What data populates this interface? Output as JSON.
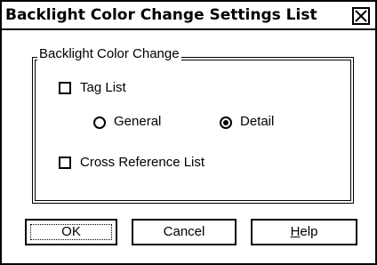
{
  "window": {
    "title": "Backlight Color Change Settings List"
  },
  "group": {
    "legend": "Backlight Color Change",
    "tag_list_label": "Tag List",
    "tag_list_checked": false,
    "radio_general_label": "General",
    "radio_detail_label": "Detail",
    "selected_radio": "Detail",
    "cross_reference_label": "Cross Reference List",
    "cross_reference_checked": false
  },
  "buttons": {
    "ok_label": "OK",
    "cancel_label": "Cancel",
    "help_label_access_key": "H",
    "help_label_rest": "elp"
  },
  "icons": {
    "close": "close-icon",
    "radio_unselected": "radio-unselected-icon",
    "radio_selected": "radio-selected-icon"
  }
}
